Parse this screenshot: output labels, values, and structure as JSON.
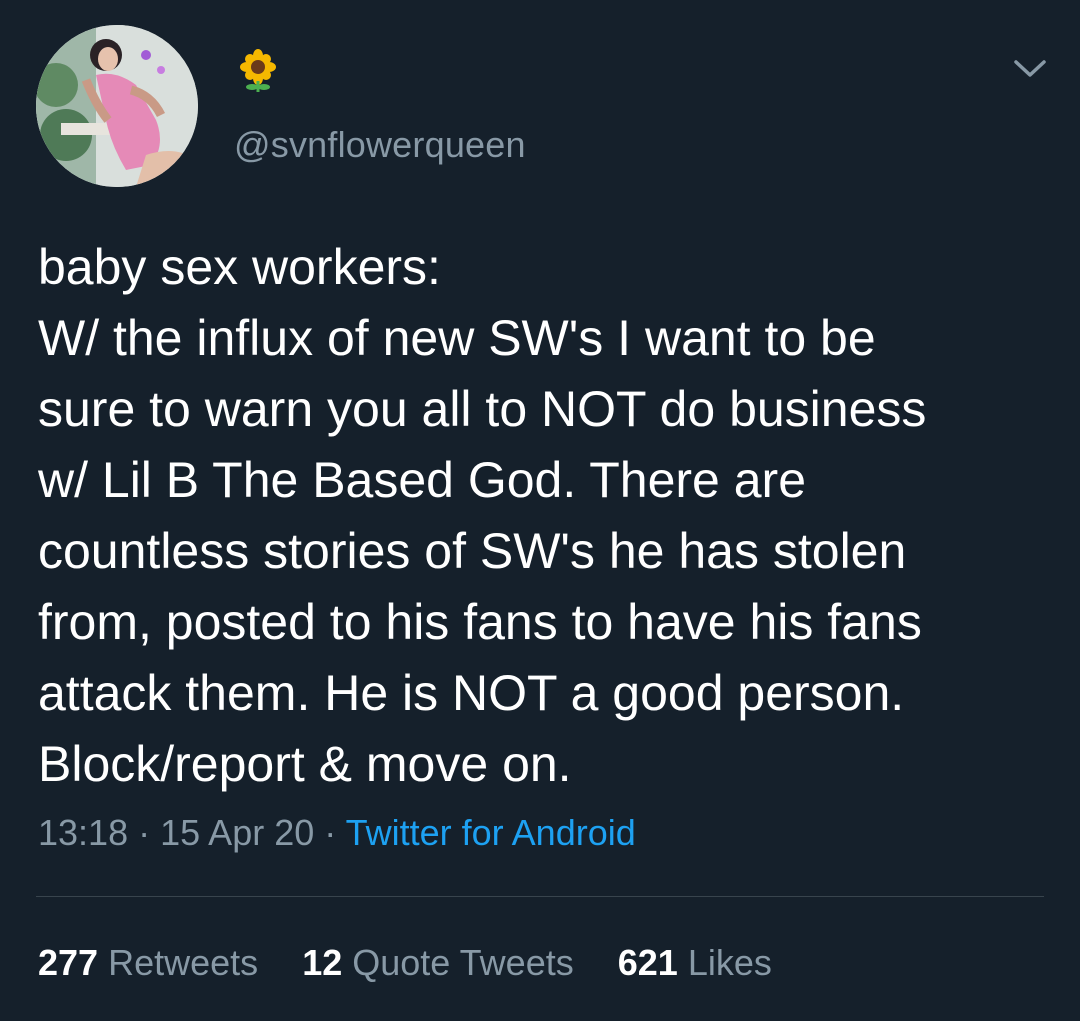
{
  "user": {
    "name_emoji": "🌻",
    "handle": "@svnflowerqueen"
  },
  "tweet": {
    "lines": [
      "baby sex workers:",
      "W/ the influx of new SW's I want to be",
      "sure to warn you all to NOT do business",
      "w/ Lil B The Based God. There are",
      "countless stories of SW's he has stolen",
      "from, posted to his fans to have his fans",
      "attack them. He is NOT a good person.",
      "Block/report & move on."
    ],
    "time": "13:18",
    "date": "15 Apr 20",
    "separator": "·",
    "source": "Twitter for Android"
  },
  "stats": {
    "retweets_count": "277",
    "retweets_label": "Retweets",
    "quotes_count": "12",
    "quotes_label": "Quote Tweets",
    "likes_count": "621",
    "likes_label": "Likes"
  },
  "colors": {
    "background": "#15202b",
    "secondary_text": "#8899a6",
    "accent": "#1da1f2",
    "divider": "#38444d"
  },
  "icons": {
    "more_menu": "chevron-down-icon",
    "profile_picture": "avatar"
  }
}
